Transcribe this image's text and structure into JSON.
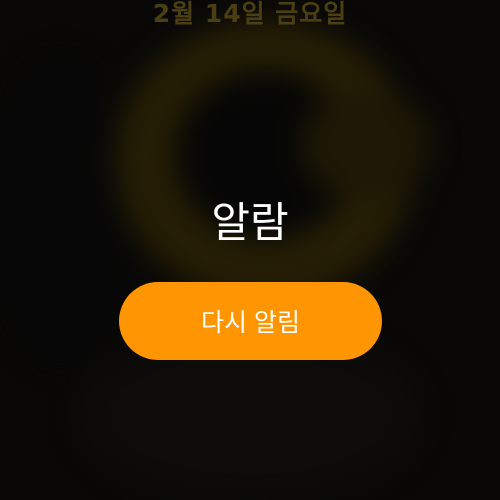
{
  "lock_screen": {
    "date": "2월 14일 금요일"
  },
  "alarm": {
    "title": "알람",
    "snooze_label": "다시 알림"
  },
  "colors": {
    "accent": "#ff9500",
    "text": "#ffffff",
    "background": "#0e0d0b"
  }
}
